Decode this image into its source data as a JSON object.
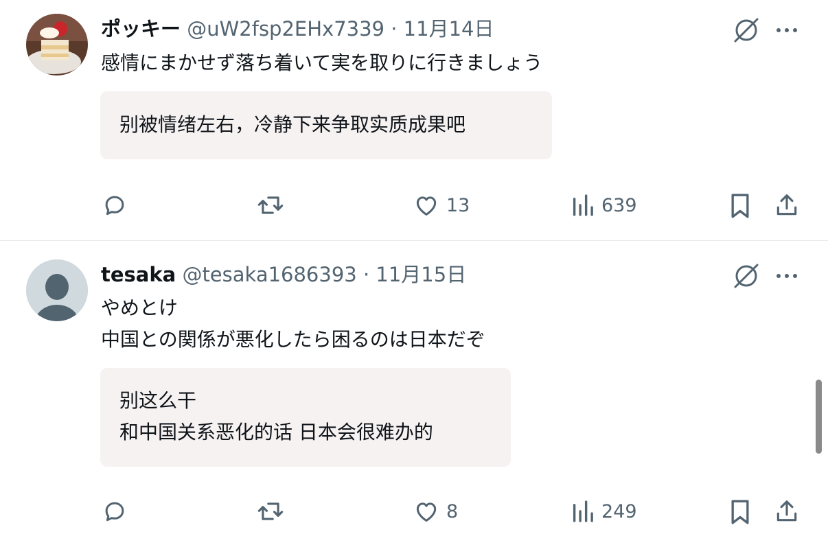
{
  "tweets": [
    {
      "display_name": "ポッキー",
      "handle": "@uW2fsp2EHx7339",
      "date": "11月14日",
      "lines": [
        "感情にまかせず落ち着いて実を取りに行きましょう"
      ],
      "translation": [
        "别被情绪左右，冷静下来争取实质成果吧"
      ],
      "likes": "13",
      "views": "639"
    },
    {
      "display_name": "tesaka",
      "handle": "@tesaka1686393",
      "date": "11月15日",
      "lines": [
        "やめとけ",
        "中国との関係が悪化したら困るのは日本だぞ"
      ],
      "translation": [
        "别这么干",
        "和中国关系恶化的话 日本会很难办的"
      ],
      "likes": "8",
      "views": "249"
    }
  ],
  "separator": "·",
  "icons": {
    "grok": "grok-slash-circle-icon",
    "more": "more-dots-icon",
    "reply": "reply-bubble-icon",
    "repost": "repost-arrows-icon",
    "like": "heart-icon",
    "views": "bar-chart-icon",
    "bookmark": "bookmark-icon",
    "share": "share-upload-icon"
  },
  "colors": {
    "text": "#0f1419",
    "muted": "#536471",
    "translation_bg": "#f7f2f2"
  }
}
